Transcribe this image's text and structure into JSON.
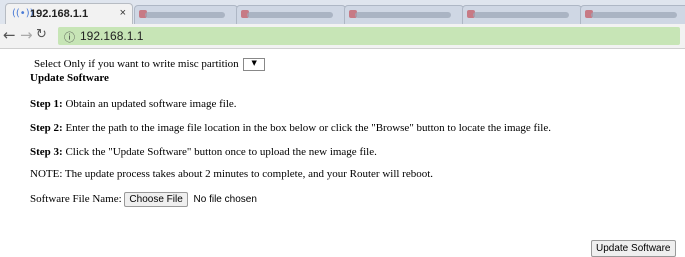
{
  "browser": {
    "active_tab_title": "192.168.1.1",
    "address": "192.168.1.1"
  },
  "page": {
    "misc_prompt": "Select Only if you want to write misc partition",
    "heading": "Update Software",
    "step1_label": "Step 1:",
    "step1_text": "Obtain an updated software image file.",
    "step2_label": "Step 2:",
    "step2_text": "Enter the path to the image file location in the box below or click the \"Browse\" button to locate the image file.",
    "step3_label": "Step 3:",
    "step3_text": "Click the \"Update Software\" button once to upload the new image file.",
    "note": "NOTE: The update process takes about 2 minutes to complete, and your Router will reboot.",
    "file_label": "Software File Name:",
    "choose_file": "Choose File",
    "no_file": "No file chosen",
    "update_button": "Update Software"
  }
}
